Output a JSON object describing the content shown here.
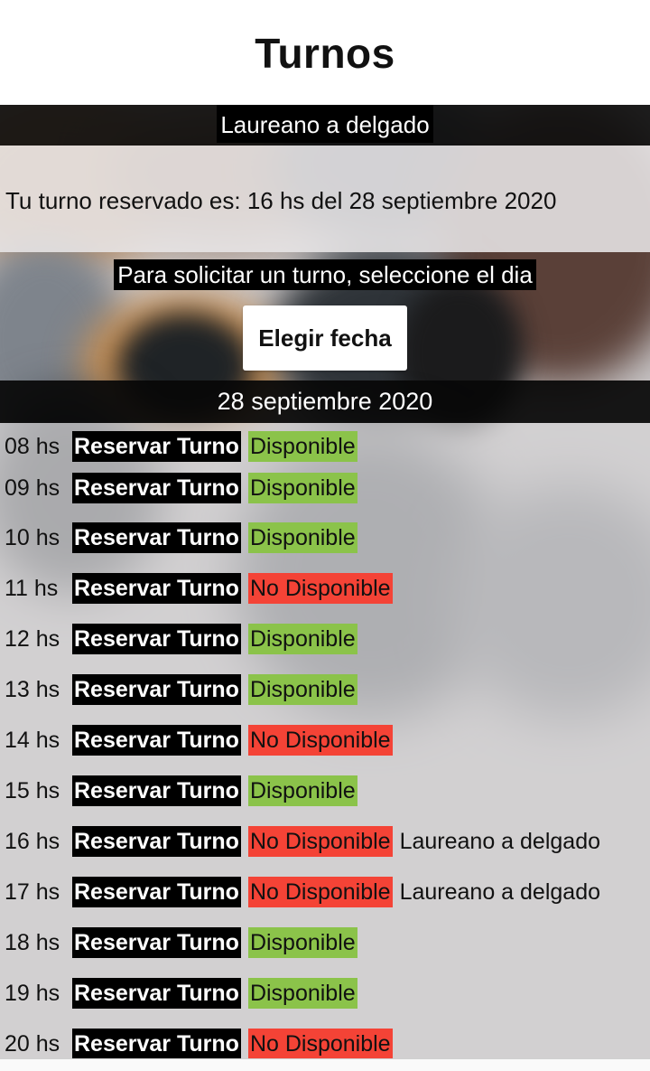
{
  "header": {
    "title": "Turnos"
  },
  "user": {
    "name": "Laureano a delgado"
  },
  "reservation": {
    "text": "Tu turno reservado es: 16 hs del 28 septiembre 2020"
  },
  "instructions": {
    "text": "Para solicitar un turno, seleccione el dia"
  },
  "date_button": {
    "label": "Elegir fecha"
  },
  "selected_date": "28 septiembre 2020",
  "colors": {
    "available": "#8bc34a",
    "unavailable": "#f44336"
  },
  "slots": [
    {
      "hour": "08 hs",
      "action": "Reservar Turno",
      "status": "Disponible",
      "available": true,
      "owner": ""
    },
    {
      "hour": "09 hs",
      "action": "Reservar Turno",
      "status": "Disponible",
      "available": true,
      "owner": ""
    },
    {
      "hour": "10 hs",
      "action": "Reservar Turno",
      "status": "Disponible",
      "available": true,
      "owner": ""
    },
    {
      "hour": "11 hs",
      "action": "Reservar Turno",
      "status": "No Disponible",
      "available": false,
      "owner": ""
    },
    {
      "hour": "12 hs",
      "action": "Reservar Turno",
      "status": "Disponible",
      "available": true,
      "owner": ""
    },
    {
      "hour": "13 hs",
      "action": "Reservar Turno",
      "status": "Disponible",
      "available": true,
      "owner": ""
    },
    {
      "hour": "14 hs",
      "action": "Reservar Turno",
      "status": "No Disponible",
      "available": false,
      "owner": ""
    },
    {
      "hour": "15 hs",
      "action": "Reservar Turno",
      "status": "Disponible",
      "available": true,
      "owner": ""
    },
    {
      "hour": "16 hs",
      "action": "Reservar Turno",
      "status": "No Disponible",
      "available": false,
      "owner": "Laureano a delgado"
    },
    {
      "hour": "17 hs",
      "action": "Reservar Turno",
      "status": "No Disponible",
      "available": false,
      "owner": "Laureano a delgado"
    },
    {
      "hour": "18 hs",
      "action": "Reservar Turno",
      "status": "Disponible",
      "available": true,
      "owner": ""
    },
    {
      "hour": "19 hs",
      "action": "Reservar Turno",
      "status": "Disponible",
      "available": true,
      "owner": ""
    },
    {
      "hour": "20 hs",
      "action": "Reservar Turno",
      "status": "No Disponible",
      "available": false,
      "owner": ""
    }
  ]
}
